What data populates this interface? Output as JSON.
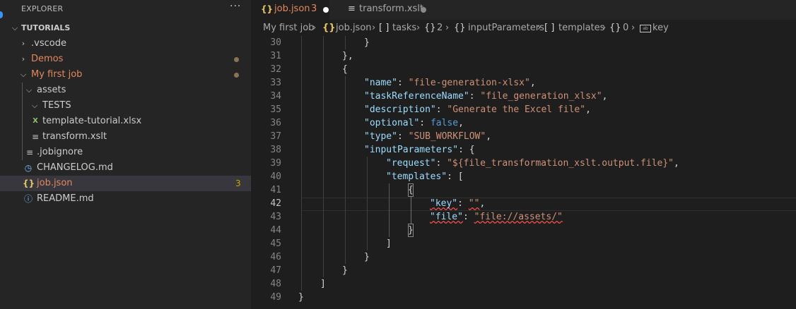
{
  "sidebar": {
    "title": "EXPLORER",
    "more": "···",
    "section": "TUTORIALS",
    "items": [
      {
        "label": ".vscode",
        "icon": "chevron-right"
      },
      {
        "label": "Demos",
        "icon": "chevron-right"
      },
      {
        "label": "My first job",
        "icon": "chevron-down"
      },
      {
        "label": "assets",
        "icon": "chevron-down"
      },
      {
        "label": "TESTS",
        "icon": "chevron-down"
      },
      {
        "label": "template-tutorial.xlsx",
        "icon": "excel-file-icon"
      },
      {
        "label": "transform.xslt",
        "icon": "lines-file-icon"
      },
      {
        "label": ".jobignore",
        "icon": "lines-file-icon"
      },
      {
        "label": "CHANGELOG.md",
        "icon": "history-icon"
      },
      {
        "label": "job.json",
        "icon": "json-braces-icon",
        "count": "3"
      },
      {
        "label": "README.md",
        "icon": "info-icon"
      }
    ]
  },
  "tabs": [
    {
      "label": "job.json",
      "problems": "3"
    },
    {
      "label": "transform.xslt"
    }
  ],
  "breadcrumb": {
    "items": [
      "My first job",
      "job.json",
      "tasks",
      "2",
      "inputParameters",
      "templates",
      "0",
      "key"
    ],
    "icons": [
      "",
      "{}",
      "[ ]",
      "{}",
      "{}",
      "[ ]",
      "{}",
      "key-icon"
    ]
  },
  "editor": {
    "current_line": 42,
    "lines": [
      {
        "n": "30"
      },
      {
        "n": "31"
      },
      {
        "n": "32"
      },
      {
        "n": "33"
      },
      {
        "n": "34"
      },
      {
        "n": "35"
      },
      {
        "n": "36"
      },
      {
        "n": "37"
      },
      {
        "n": "38"
      },
      {
        "n": "39"
      },
      {
        "n": "40"
      },
      {
        "n": "41"
      },
      {
        "n": "42"
      },
      {
        "n": "43"
      },
      {
        "n": "44"
      },
      {
        "n": "45"
      },
      {
        "n": "46"
      },
      {
        "n": "47"
      },
      {
        "n": "48"
      },
      {
        "n": "49"
      }
    ],
    "code": {
      "l30": "}",
      "l31": "},",
      "l32": "{",
      "l33_key": "\"name\"",
      "l33_val": "\"file-generation-xlsx\"",
      "l34_key": "\"taskReferenceName\"",
      "l34_val": "\"file_generation_xlsx\"",
      "l35_key": "\"description\"",
      "l35_val": "\"Generate the Excel file\"",
      "l36_key": "\"optional\"",
      "l36_val": "false",
      "l37_key": "\"type\"",
      "l37_val": "\"SUB_WORKFLOW\"",
      "l38_key": "\"inputParameters\"",
      "l38_rest": ": {",
      "l39_key": "\"request\"",
      "l39_val": "\"${file_transformation_xslt.output.file}\"",
      "l40_key": "\"templates\"",
      "l40_rest": ": [",
      "l41": "{",
      "l42_key": "\"key\"",
      "l42_val": "\"\"",
      "l43_key": "\"file\"",
      "l43_val": "\"file://assets/\"",
      "l44": "}",
      "l45": "]",
      "l46": "}",
      "l47": "}",
      "l48": "]",
      "l49": "}"
    }
  },
  "colors": {
    "accent": "#3794ff",
    "warning": "#cca700",
    "modified": "#e2885d"
  }
}
